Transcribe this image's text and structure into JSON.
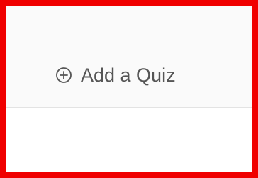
{
  "action": {
    "label": "Add a Quiz",
    "icon": "plus-circle-icon"
  },
  "colors": {
    "outline": "#f00000",
    "text": "#555555",
    "background_top": "#fafafa",
    "divider": "#e3e3e3"
  }
}
